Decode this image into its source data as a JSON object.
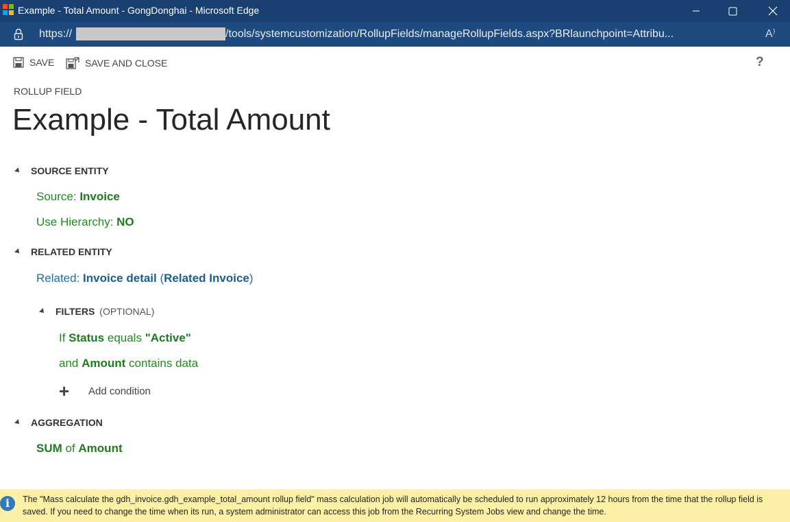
{
  "window": {
    "title": "Example - Total Amount - GongDonghai - Microsoft Edge"
  },
  "address_bar": {
    "url_prefix": "https://",
    "url_suffix": "/tools/systemcustomization/RollupFields/manageRollupFields.aspx?BRlaunchpoint=Attribu...",
    "read_aloud": "A⁾"
  },
  "toolbar": {
    "save_label": "SAVE",
    "save_and_close_label": "SAVE AND CLOSE",
    "help_label": "?"
  },
  "header": {
    "eyebrow": "ROLLUP FIELD",
    "title": "Example - Total Amount"
  },
  "source_entity": {
    "heading": "SOURCE ENTITY",
    "source_label": "Source: ",
    "source_value": "Invoice",
    "hierarchy_label": "Use Hierarchy: ",
    "hierarchy_value": "NO"
  },
  "related_entity": {
    "heading": "RELATED ENTITY",
    "related_label": "Related: ",
    "related_value": "Invoice detail",
    "paren_open": " (",
    "relationship_value": "Related Invoice",
    "paren_close": ")"
  },
  "filters": {
    "heading": "FILTERS",
    "optional": "(OPTIONAL)",
    "condition1": {
      "prefix": "If ",
      "field": "Status",
      "operator": " equals ",
      "value": "\"Active\""
    },
    "condition2": {
      "prefix": "and ",
      "field": "Amount",
      "operator": " contains data"
    },
    "add_condition": "Add condition"
  },
  "aggregation": {
    "heading": "AGGREGATION",
    "function": "SUM",
    "of": " of ",
    "field": "Amount"
  },
  "notification": {
    "message": "The \"Mass calculate the gdh_invoice.gdh_example_total_amount rollup field\" mass calculation job will automatically be scheduled to run approximately 12 hours from the time that the rollup field is saved. If you need to change the time when its run, a system administrator can access this job from the Recurring System Jobs view and change the time."
  },
  "colors": {
    "titlebar": "#1a4072",
    "addressbar": "#1e4a7f",
    "green_value": "#1d7a1d",
    "blue_value": "#1a5f8e",
    "notice_bg": "#fdf1a8"
  }
}
